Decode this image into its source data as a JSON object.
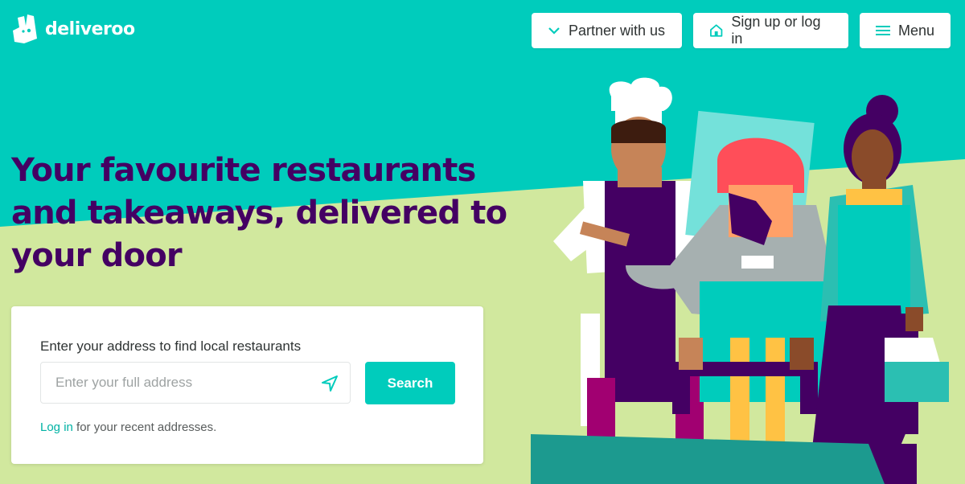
{
  "brand": {
    "name": "deliveroo",
    "colors": {
      "teal": "#00ccbc",
      "lime": "#d1e89e",
      "purple": "#440063",
      "white": "#ffffff"
    }
  },
  "header": {
    "logo_icon": "kangaroo-icon",
    "nav": [
      {
        "label": "Partner with us",
        "icon": "chevron-down-icon"
      },
      {
        "label": "Sign up or log in",
        "icon": "home-icon"
      },
      {
        "label": "Menu",
        "icon": "hamburger-icon"
      }
    ]
  },
  "hero": {
    "headline_lines": [
      "Your favourite restaurants",
      "and takeaways, delivered to",
      "your door"
    ]
  },
  "search_card": {
    "label": "Enter your address to find local restaurants",
    "placeholder": "Enter your full address",
    "location_icon": "location-arrow-icon",
    "button_label": "Search",
    "login_link": "Log in",
    "login_suffix": " for your recent addresses."
  },
  "illustration": {
    "figures": [
      "chef",
      "rider",
      "customer"
    ]
  }
}
